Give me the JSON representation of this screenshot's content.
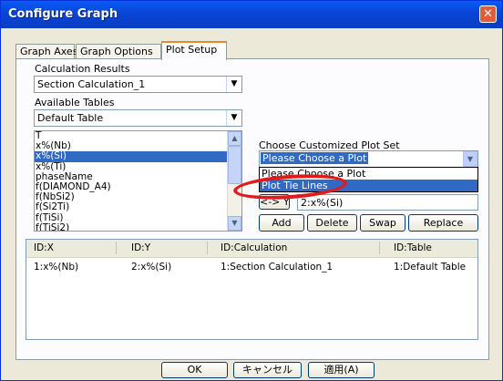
{
  "window": {
    "title": "Configure Graph",
    "close_glyph": "✕"
  },
  "tabs": [
    {
      "label": "Graph Axes"
    },
    {
      "label": "Graph Options"
    },
    {
      "label": "Plot Setup"
    }
  ],
  "left": {
    "calc_label": "Calculation Results",
    "calc_value": "Section Calculation_1",
    "tables_label": "Available Tables",
    "tables_value": "Default Table",
    "columns": [
      "T",
      "x%(Nb)",
      "x%(Si)",
      "x%(Ti)",
      "phaseName",
      "f(DIAMOND_A4)",
      "f(NbSi2)",
      "f(Si2Ti)",
      "f(TiSi)",
      "f(TiSi2)"
    ],
    "selected_index": 2
  },
  "right": {
    "plotset_label": "Choose Customized Plot Set",
    "plotset_value": "Please Choose a Plot",
    "dropdown_options": [
      "Please Choose a Plot",
      "Plot Tie Lines"
    ],
    "swap_arrow_label": "<-> Y",
    "y_value": "2:x%(Si)",
    "buttons": {
      "add": "Add",
      "delete": "Delete",
      "swap": "Swap",
      "replace": "Replace"
    }
  },
  "grid": {
    "headers": [
      "ID:X",
      "ID:Y",
      "ID:Calculation",
      "ID:Table"
    ],
    "rows": [
      [
        "1:x%(Nb)",
        "2:x%(Si)",
        "1:Section Calculation_1",
        "1:Default Table"
      ]
    ]
  },
  "footer": {
    "ok": "OK",
    "cancel": "キャンセル",
    "apply": "適用(A)"
  },
  "colors": {
    "title_bar": "#0a4fd8",
    "selection": "#316ac5",
    "highlight_ring": "#e3191a"
  }
}
